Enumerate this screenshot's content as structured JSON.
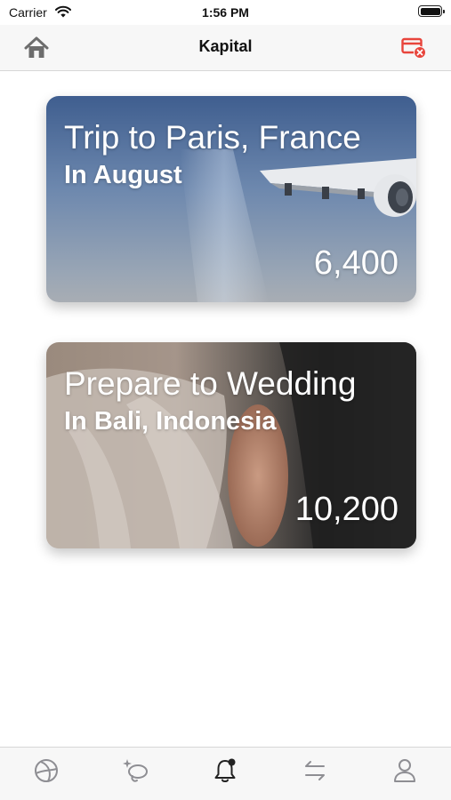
{
  "status_bar": {
    "carrier": "Carrier",
    "time": "1:56 PM"
  },
  "nav": {
    "title": "Kapital",
    "left_icon": "home-icon",
    "right_icon": "card-remove-icon",
    "accent_color": "#e8453c"
  },
  "cards": [
    {
      "title": "Trip to Paris, France",
      "subtitle": "In August",
      "amount": "6,400",
      "image": "airplane-wing-sky"
    },
    {
      "title": "Prepare to Wedding",
      "subtitle": "In Bali, Indonesia",
      "amount": "10,200",
      "image": "wedding-couple"
    }
  ],
  "tab_bar": {
    "items": [
      {
        "icon": "globe-icon"
      },
      {
        "icon": "sparkle-lasso-icon"
      },
      {
        "icon": "bell-badge-icon",
        "selected": true
      },
      {
        "icon": "transfer-arrows-icon"
      },
      {
        "icon": "person-icon"
      }
    ],
    "inactive_color": "#8e8e93",
    "active_color": "#222222"
  }
}
